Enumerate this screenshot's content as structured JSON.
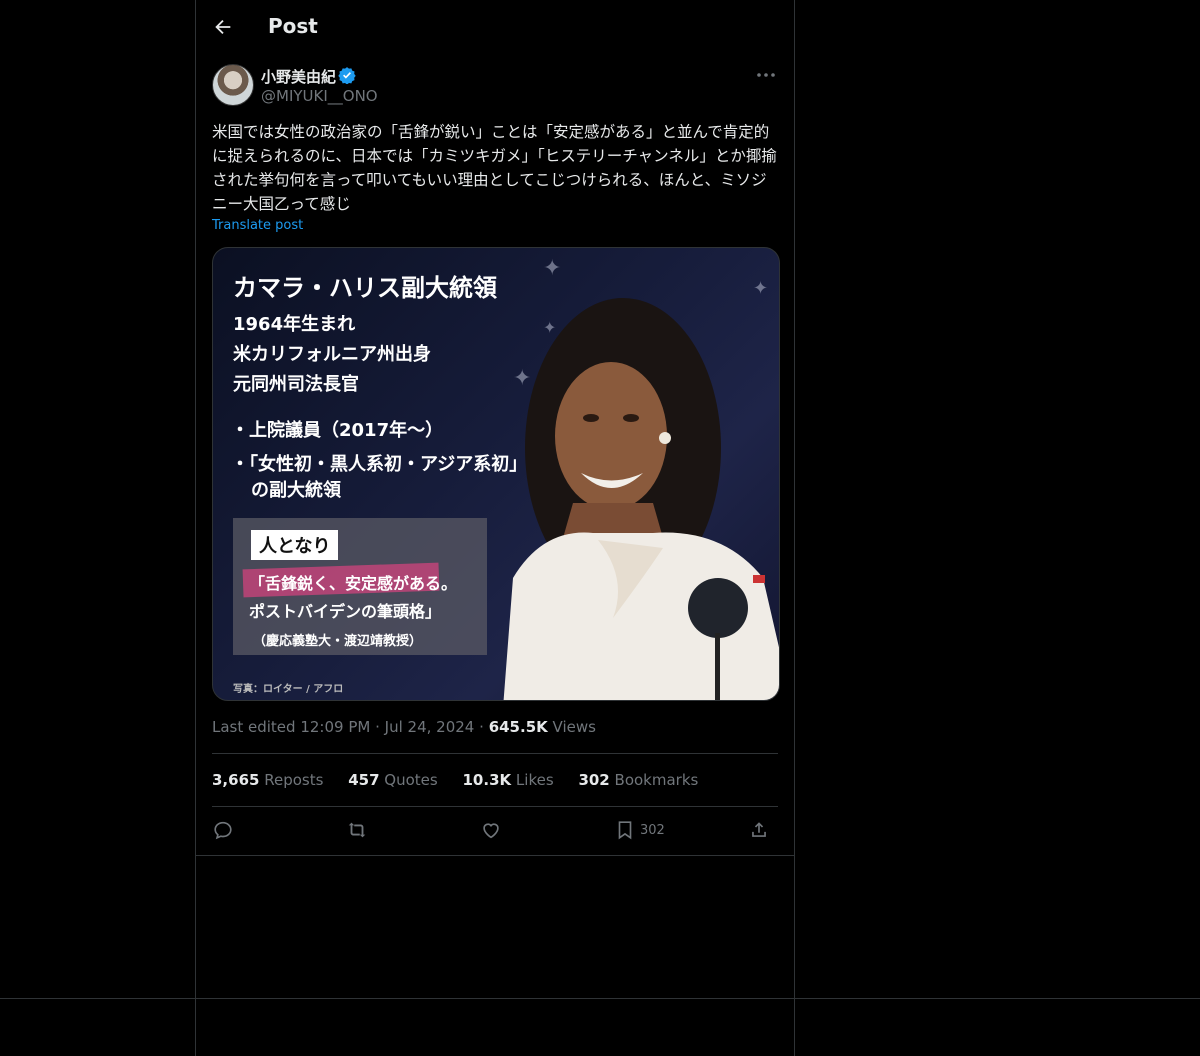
{
  "header": {
    "title": "Post"
  },
  "author": {
    "name": "小野美由紀",
    "handle": "@MIYUKI__ONO"
  },
  "post": {
    "text": "米国では女性の政治家の「舌鋒が鋭い」ことは「安定感がある」と並んで肯定的に捉えられるのに、日本では「カミツキガメ」「ヒステリーチャンネル」とか揶揄された挙句何を言って叩いてもいい理由としてこじつけられる、ほんと、ミソジニー大国乙って感じ",
    "translate_label": "Translate post"
  },
  "media": {
    "title": "カマラ・ハリス副大統領",
    "lines": [
      "1964年生まれ",
      "米カリフォルニア州出身",
      "元同州司法長官"
    ],
    "bullets": [
      "・上院議員（2017年〜）",
      "・「女性初・黒人系初・アジア系初」",
      "の副大統領"
    ],
    "tag": "人となり",
    "quote_line1": "「舌鋒鋭く、安定感がある。",
    "quote_line2": "ポストバイデンの筆頭格」",
    "source": "（慶応義塾大・渡辺靖教授）",
    "credit": "写真：ロイター / アフロ"
  },
  "meta": {
    "edited": "Last edited 12:09 PM",
    "dot": "·",
    "date": "Jul 24, 2024",
    "views_count": "645.5K",
    "views_label": "Views"
  },
  "stats": {
    "reposts_count": "3,665",
    "reposts_label": "Reposts",
    "quotes_count": "457",
    "quotes_label": "Quotes",
    "likes_count": "10.3K",
    "likes_label": "Likes",
    "bookmarks_count": "302",
    "bookmarks_label": "Bookmarks"
  },
  "actions": {
    "bookmark_count": "302"
  },
  "colors": {
    "background": "#000000",
    "accent": "#1d9bf0",
    "border": "#2f3336",
    "muted": "#71767b",
    "text": "#e7e9ea"
  }
}
